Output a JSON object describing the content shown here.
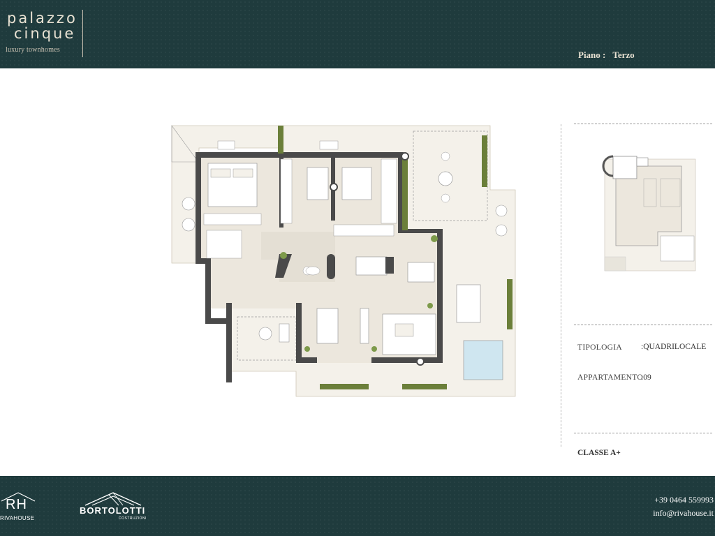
{
  "brand": {
    "name_line1": "palazzo",
    "name_line2": "cinque",
    "tagline": "luxury townhomes"
  },
  "floor": {
    "label": "Piano :",
    "value": "Terzo"
  },
  "info": {
    "tipologia_label": "TIPOLOGIA",
    "tipologia_value": ":QUADRILOCALE",
    "appartamento_label": "APPARTAMENTO",
    "appartamento_value": ":09",
    "classe": "CLASSE A+"
  },
  "footer": {
    "rh_monogram": "RH",
    "rh_name": "RIVAHOUSE",
    "bortolotti_name": "BORTOLOTTI",
    "bortolotti_sub": "COSTRUZIONI",
    "phone": "+39 0464 559993",
    "email": "info@rivahouse.it"
  },
  "colors": {
    "brand_dark": "#1f3b3d",
    "brand_cream": "#e9e2d3",
    "wall": "#4a4a4a",
    "floor_fill": "#ece7dd",
    "terrace_fill": "#f4f1ea",
    "pool": "#cfe6f0"
  },
  "icons": {
    "plan": "floor-plan-drawing",
    "keyplan": "building-key-plan",
    "rh_logo": "house-roof-icon",
    "bortolotti_logo": "roof-lines-icon"
  }
}
